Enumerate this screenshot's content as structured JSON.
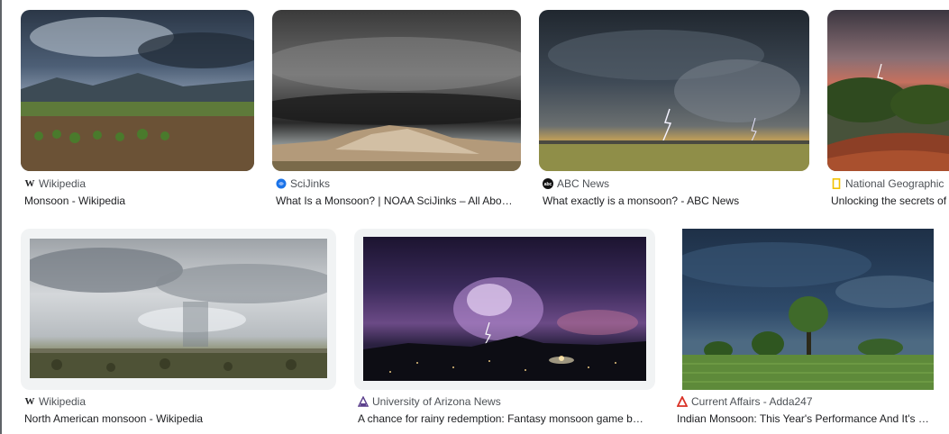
{
  "results": [
    {
      "source": "Wikipedia",
      "favicon": "wikipedia-w-icon",
      "title": "Monsoon - Wikipedia",
      "image": "monsoon-field-storm-clouds"
    },
    {
      "source": "SciJinks",
      "favicon": "scijinks-icon",
      "title": "What Is a Monsoon? | NOAA SciJinks – All Abo…",
      "image": "dark-shelf-cloud-over-badlands"
    },
    {
      "source": "ABC News",
      "favicon": "abc-news-icon",
      "title": "What exactly is a monsoon? - ABC News",
      "image": "lightning-storm-over-grassland"
    },
    {
      "source": "National Geographic",
      "favicon": "natgeo-frame-icon",
      "title": "Unlocking the secrets of",
      "image": "red-sky-storm-with-lightning"
    },
    {
      "source": "Wikipedia",
      "favicon": "wikipedia-w-icon",
      "title": "North American monsoon - Wikipedia",
      "image": "rain-shaft-over-plains"
    },
    {
      "source": "University of Arizona News",
      "favicon": "university-arizona-icon",
      "title": "A chance for rainy redemption: Fantasy monsoon game b…",
      "image": "purple-lightning-over-city"
    },
    {
      "source": "Current Affairs - Adda247",
      "favicon": "adda247-icon",
      "title": "Indian Monsoon: This Year's Performance And It's …",
      "image": "tree-under-dark-sky-crops"
    }
  ],
  "colors": {
    "source_text": "#4d5156",
    "title_text": "#202124",
    "thumb_bg": "#f1f3f4",
    "adda_red": "#d93025",
    "scijinks_blue": "#1a73e8"
  }
}
